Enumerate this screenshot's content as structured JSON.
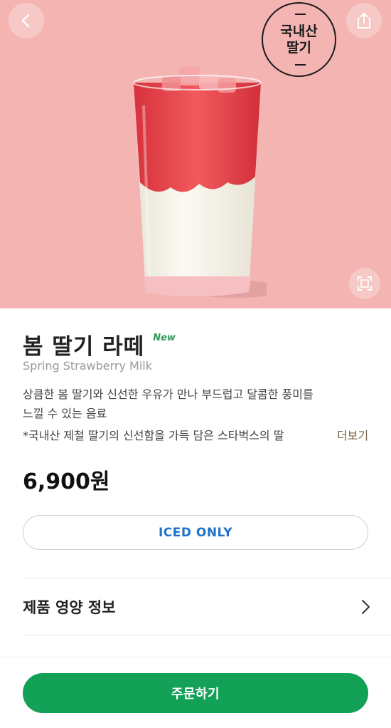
{
  "header": {
    "back_icon": "chevron-left-icon",
    "share_icon": "share-icon",
    "fullscreen_icon": "fullscreen-icon"
  },
  "stamp": {
    "line1": "국내산",
    "line2": "딸기"
  },
  "product": {
    "name": "봄 딸기 라떼",
    "badge": "New",
    "english_name": "Spring Strawberry Milk",
    "description_line1": "상큼한 봄 딸기와 신선한 우유가 만나 부드럽고 달콤한 풍미를",
    "description_line2": "느낄 수 있는 음료",
    "description_line3": " *국내산 제철 딸기의 신선함을 가득 담은 스타벅스의 딸",
    "more_label": "더보기",
    "price": "6,900원",
    "temperature_option": "ICED ONLY"
  },
  "nutrition": {
    "label": "제품 영양 정보",
    "icon": "chevron-right-icon"
  },
  "order": {
    "label": "주문하기"
  },
  "colors": {
    "hero_bg": "#f3b4b2",
    "accent_green": "#13a157",
    "iced_blue": "#1f73c9",
    "new_green": "#2d9a5a"
  }
}
